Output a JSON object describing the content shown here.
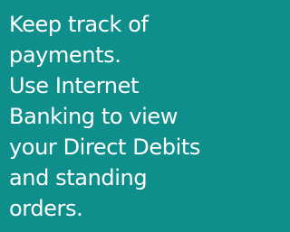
{
  "promo": {
    "lines": [
      "Keep track of",
      "payments.",
      "Use Internet",
      "Banking to view",
      "your Direct Debits",
      "and standing",
      "orders."
    ]
  },
  "colors": {
    "background": "#0f8f8c",
    "text": "#ffffff"
  }
}
